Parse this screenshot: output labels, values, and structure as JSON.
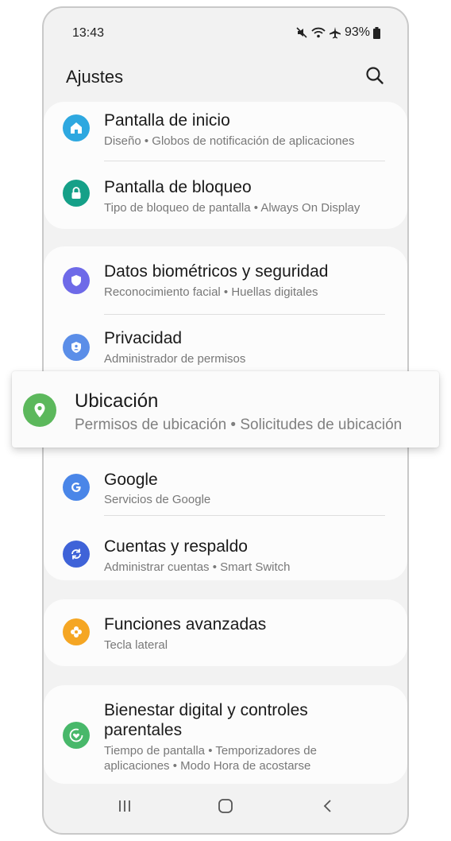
{
  "status": {
    "time": "13:43",
    "battery": "93%"
  },
  "header": {
    "title": "Ajustes"
  },
  "items": {
    "home": {
      "title": "Pantalla de inicio",
      "sub": "Diseño  •  Globos de notificación de aplicaciones",
      "color": "#2ea8e0"
    },
    "lock": {
      "title": "Pantalla de bloqueo",
      "sub": "Tipo de bloqueo de pantalla  •  Always On Display",
      "color": "#15a088"
    },
    "bio": {
      "title": "Datos biométricos y seguridad",
      "sub": "Reconocimiento facial  •  Huellas digitales",
      "color": "#6e6ae8"
    },
    "privacy": {
      "title": "Privacidad",
      "sub": "Administrador de permisos",
      "color": "#5b8ee8"
    },
    "location": {
      "title": "Ubicación",
      "sub": "Permisos de ubicación  •  Solicitudes de ubicación",
      "color": "#5cb85c"
    },
    "google": {
      "title": "Google",
      "sub": "Servicios de Google",
      "color": "#4a86e8"
    },
    "accounts": {
      "title": "Cuentas y respaldo",
      "sub": "Administrar cuentas  •  Smart Switch",
      "color": "#3f63d8"
    },
    "advanced": {
      "title": "Funciones avanzadas",
      "sub": "Tecla lateral",
      "color": "#f5a623"
    },
    "wellbeing": {
      "title_line1": "Bienestar digital y controles",
      "title_line2": "parentales",
      "sub_line1": "Tiempo de pantalla  •  Temporizadores de",
      "sub_line2": "aplicaciones  •  Modo Hora de acostarse",
      "color": "#48b86a"
    }
  }
}
